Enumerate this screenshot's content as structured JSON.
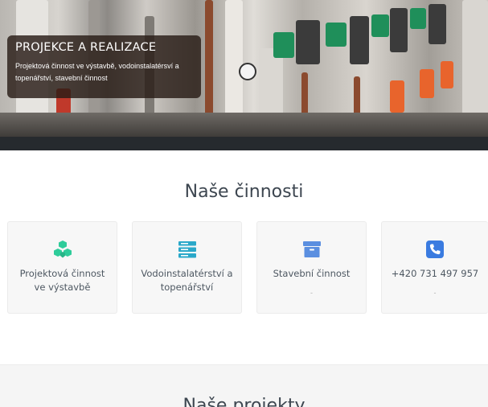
{
  "hero": {
    "title": "PROJEKCE A REALIZACE",
    "subtitle": "Projektová činnost ve výstavbě, vodoinstalatérsví a topenářství, stavební činnost"
  },
  "services": {
    "heading": "Naše činnosti",
    "cards": [
      {
        "label": "Projektová činnost ve výstavbě",
        "sub": "",
        "icon": "cubes-icon",
        "color": "#2ecc9a"
      },
      {
        "label": "Vodoinstalatérství a topenářství",
        "sub": "",
        "icon": "server-icon",
        "color": "#2aa8c9"
      },
      {
        "label": "Stavební činnost",
        "sub": "-",
        "icon": "archive-icon",
        "color": "#5b8fe0"
      },
      {
        "label": "+420 731 497 957",
        "sub": "-",
        "icon": "phone-icon",
        "color": "#3a7be0"
      }
    ]
  },
  "projects": {
    "heading": "Naše projekty"
  }
}
